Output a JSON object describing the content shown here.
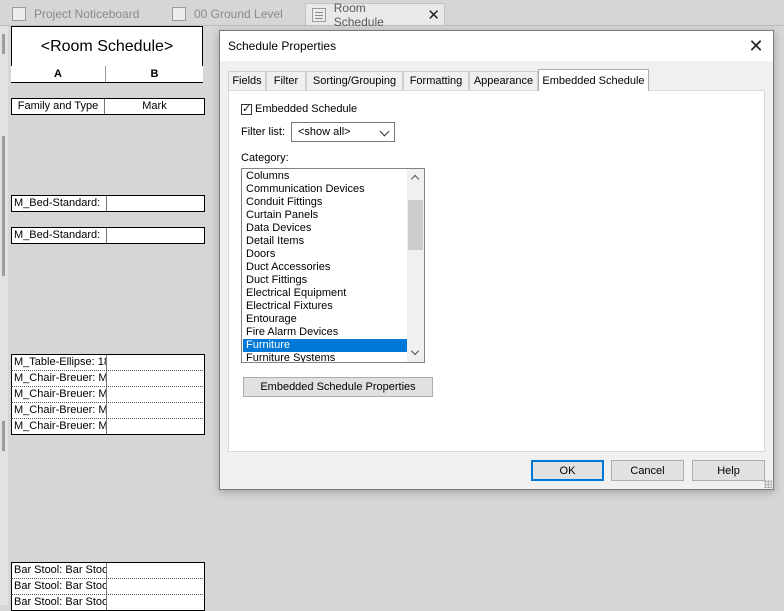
{
  "doc_tabs": [
    {
      "label": "Project Noticeboard",
      "icon": "sheet-icon",
      "active": false
    },
    {
      "label": "00 Ground Level",
      "icon": "floor-plan-icon",
      "active": false
    },
    {
      "label": "Room Schedule",
      "icon": "schedule-icon",
      "active": true
    }
  ],
  "schedule": {
    "title": "<Room Schedule>",
    "col_a": "A",
    "col_b": "B",
    "header_a": "Family and Type",
    "header_b": "Mark",
    "rows": [
      "M_Bed-Standard:",
      "M_Bed-Standard:",
      "M_Table-Ellipse: 18",
      "M_Chair-Breuer: M",
      "M_Chair-Breuer: M",
      "M_Chair-Breuer: M",
      "M_Chair-Breuer: M",
      "Bar Stool: Bar Stoo",
      "Bar Stool: Bar Stoo",
      "Bar Stool: Bar Stoo"
    ]
  },
  "dialog": {
    "title": "Schedule Properties",
    "tabs": [
      "Fields",
      "Filter",
      "Sorting/Grouping",
      "Formatting",
      "Appearance",
      "Embedded Schedule"
    ],
    "active_tab": "Embedded Schedule",
    "embedded_checkbox_label": "Embedded Schedule",
    "embedded_checked": true,
    "filter_label": "Filter list:",
    "filter_value": "<show all>",
    "category_label": "Category:",
    "categories": [
      "Columns",
      "Communication Devices",
      "Conduit Fittings",
      "Curtain Panels",
      "Data Devices",
      "Detail Items",
      "Doors",
      "Duct Accessories",
      "Duct Fittings",
      "Electrical Equipment",
      "Electrical Fixtures",
      "Entourage",
      "Fire Alarm Devices",
      "Furniture",
      "Furniture Systems"
    ],
    "selected_category": "Furniture",
    "embedded_props_button": "Embedded Schedule Properties",
    "ok": "OK",
    "cancel": "Cancel",
    "help": "Help",
    "accent_color": "#0078d7"
  }
}
